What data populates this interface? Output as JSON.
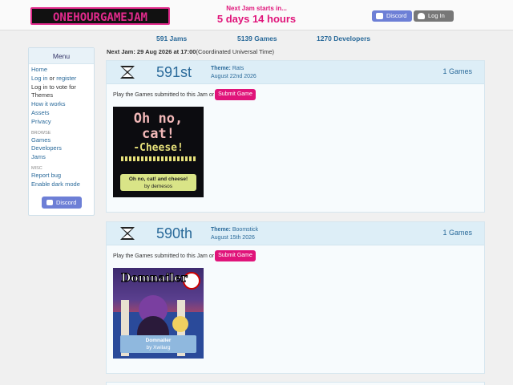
{
  "header": {
    "logo_text": "ONEHOURGAMEJAM",
    "next_jam_label": "Next Jam starts in...",
    "countdown": "5 days 14 hours",
    "discord_label": "Discord",
    "login_label": "Log In"
  },
  "stats": {
    "jams": "591 Jams",
    "games": "5139 Games",
    "developers": "1270 Developers"
  },
  "sidebar": {
    "title": "Menu",
    "home": "Home",
    "login": "Log in",
    "or": "or",
    "register": "register",
    "vote_note": "Log in to vote for Themes",
    "how_it_works": "How it works",
    "assets": "Assets",
    "privacy": "Privacy",
    "browse_label": "BROWSE",
    "games": "Games",
    "developers": "Developers",
    "jams": "Jams",
    "misc_label": "MISC",
    "report_bug": "Report bug",
    "dark_mode": "Enable dark mode",
    "discord": "Discord"
  },
  "next_jam": {
    "label": "Next Jam: 29 Aug 2026 at 17:00",
    "tz": "(Coordinated Universal Time)"
  },
  "jams": [
    {
      "rank": "591st",
      "theme_label": "Theme:",
      "theme": "Rats",
      "date": "August 22nd 2026",
      "games_count": "1 Games",
      "play_text": "Play the Games submitted to this Jam or",
      "submit_label": "Submit Game",
      "game": {
        "cover_text_1": "Oh no,",
        "cover_text_2": "cat!",
        "cover_text_3": "-Cheese!",
        "title": "Oh no, cat! and cheese!",
        "byline": "by demesos"
      }
    },
    {
      "rank": "590th",
      "theme_label": "Theme:",
      "theme": "Boomstick",
      "date": "August 15th 2026",
      "games_count": "1 Games",
      "play_text": "Play the Games submitted to this Jam or",
      "submit_label": "Submit Game",
      "game": {
        "cover_text_1": "Domnailer",
        "title": "Domnailer",
        "byline": "by Xwilarg"
      }
    }
  ],
  "colors": {
    "accent_pink": "#e0147a",
    "link_blue": "#2a6a9a",
    "discord": "#6d7fd6"
  }
}
